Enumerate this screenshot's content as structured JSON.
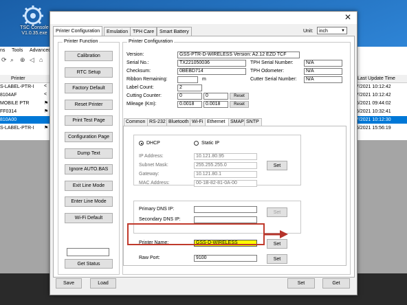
{
  "desktop": {
    "app_icon_label": "TSC Console V1.0.35.exe"
  },
  "background_app": {
    "menu": [
      "ns",
      "Tools",
      "Advanced"
    ],
    "column_printer": "Printer",
    "column_last_update": "Last Update Time",
    "rows": [
      {
        "name": "S-LABEL-PTR-I",
        "mark": "<",
        "time": "7/2021 10:12:42",
        "selected": false
      },
      {
        "name": "8104AF",
        "mark": "<",
        "time": "7/2021 10:12:42",
        "selected": false
      },
      {
        "name": "MOBILE PTR",
        "mark": "⚑",
        "time": "6/2021 09:44:02",
        "selected": false
      },
      {
        "name": "FF0314",
        "mark": "⚑",
        "time": "6/2021 10:32:41",
        "selected": false
      },
      {
        "name": "810A00",
        "mark": "",
        "time": "7/2021 10:12:30",
        "selected": true
      },
      {
        "name": "S-LABEL-PTR-I",
        "mark": "⚑",
        "time": "6/2021 15:56:19",
        "selected": false
      }
    ]
  },
  "dialog": {
    "title": "",
    "tabs": [
      "Printer Configuration",
      "Emulation",
      "TPH Care",
      "Smart Battery"
    ],
    "unit_label": "Unit:",
    "unit_value": "inch",
    "printer_function": {
      "heading": "Printer Function",
      "buttons": [
        "Calibration",
        "RTC Setup",
        "Factory Default",
        "Reset Printer",
        "Print Test Page",
        "Configuration Page",
        "Dump Text",
        "Ignore AUTO.BAS",
        "Exit Line Mode",
        "Enter Line Mode",
        "Wi-Fi Default"
      ],
      "status_value": "",
      "get_status": "Get Status"
    },
    "config": {
      "heading": "Printer Configuration",
      "version_label": "Version:",
      "version_value": "GSS-PTR-D-WIRELESS Version: A2.12 EZD TCF",
      "serial_label": "Serial No.:",
      "serial_value": "TX221050036",
      "tph_serial_label": "TPH Serial Number:",
      "tph_serial_value": "N/A",
      "checksum_label": "Checksum:",
      "checksum_value": "0BEBD714",
      "tph_odometer_label": "TPH Odometer:",
      "tph_odometer_value": "N/A",
      "ribbon_label": "Ribbon Remaining:",
      "ribbon_value": "",
      "ribbon_unit": "m",
      "cutter_serial_label": "Cutter Serial Number:",
      "cutter_serial_value": "N/A",
      "label_count_label": "Label Count:",
      "label_count_value": "2",
      "cutting_label": "Cutting Counter:",
      "cutting_value1": "0",
      "cutting_value2": "0",
      "reset_label": "Reset",
      "mileage_label": "Mileage (Km):",
      "mileage_value1": "0.0018",
      "mileage_value2": "0.0018"
    },
    "subtabs": [
      "Common",
      "RS-232",
      "Bluetooth",
      "Wi-Fi",
      "Ethernet",
      "SMAP",
      "SNTP"
    ],
    "ethernet": {
      "dhcp_label": "DHCP",
      "static_label": "Static IP",
      "mode_selected": "DHCP",
      "ip_label": "IP Address:",
      "ip_value": "10.121.80.95",
      "mask_label": "Subnet Mask:",
      "mask_value": "255.255.255.0",
      "gateway_label": "Gateway:",
      "gateway_value": "10.121.80.1",
      "mac_label": "MAC Address:",
      "mac_value": "00-1B-82-81-0A-00",
      "set_label": "Set",
      "primary_dns_label": "Primary DNS IP:",
      "primary_dns_value": "",
      "secondary_dns_label": "Secondary DNS IP:",
      "secondary_dns_value": "",
      "printer_name_label": "Printer Name:",
      "printer_name_value": "GSS-D-WIRELESS",
      "raw_port_label": "Raw Port:",
      "raw_port_value": "9100"
    },
    "bottom": {
      "save": "Save",
      "load": "Load",
      "set": "Set",
      "get": "Get"
    }
  },
  "colors": {
    "highlight_yellow": "#ffff00",
    "annotation_red": "#c0392b",
    "selection_blue": "#0078d7"
  }
}
